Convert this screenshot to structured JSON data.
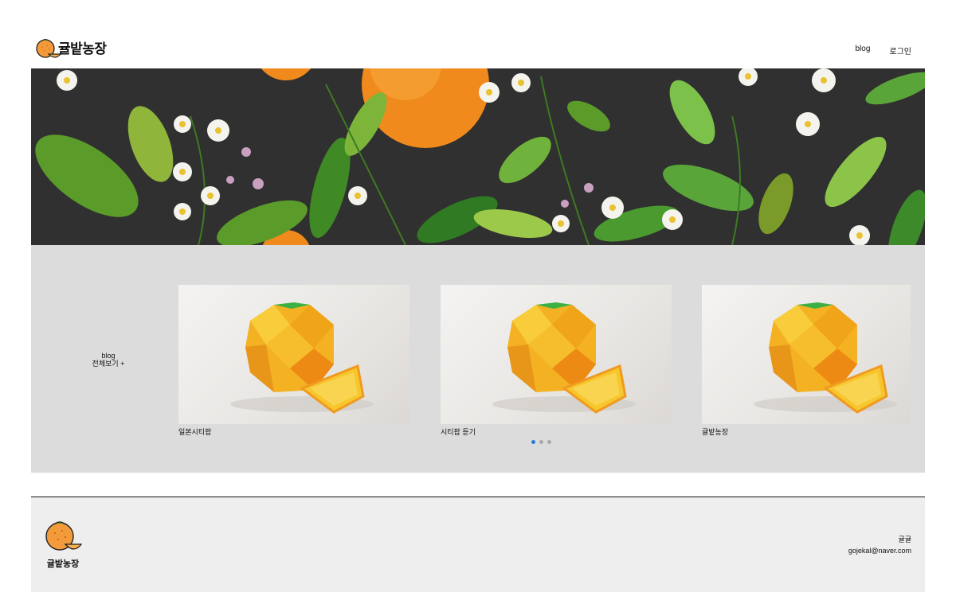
{
  "header": {
    "logo_text": "귤밭농장",
    "nav": {
      "blog": "blog",
      "login": "로그인"
    }
  },
  "hero": {
    "icon": "orange-blossom-banner"
  },
  "blog_section": {
    "title": "blog",
    "view_all": "전체보기 +",
    "cards": [
      {
        "caption": "일본시티팝"
      },
      {
        "caption": "시티팝 듣기"
      },
      {
        "caption": "귤밭농장"
      }
    ],
    "pagination": {
      "count": 3,
      "active": 1
    }
  },
  "footer": {
    "logo_text": "귤밭농장",
    "name": "귤귤",
    "email": "gojekal@naver.com"
  },
  "colors": {
    "orange": "#f39a3a",
    "active_dot": "#2a7ad6",
    "hero_bg": "#303030"
  }
}
